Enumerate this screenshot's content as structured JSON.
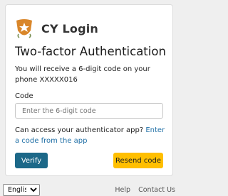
{
  "header": {
    "logo_icon": "cyprus-emblem-icon",
    "brand_name": "CY Login"
  },
  "page": {
    "title": "Two-factor Authentication",
    "description": "You will receive a 6-digit code on your phone XXXXX016"
  },
  "form": {
    "code_label": "Code",
    "code_value": "",
    "code_placeholder": "Enter the 6-digit code",
    "alt_text": "Can access your authenticator app?",
    "alt_link": "Enter a code from the app",
    "verify_label": "Verify",
    "resend_label": "Resend code"
  },
  "footer": {
    "language_selected": "English",
    "help_label": "Help",
    "contact_label": "Contact Us"
  },
  "colors": {
    "primary": "#1c6888",
    "secondary": "#ffbf00",
    "link": "#2271a7"
  }
}
